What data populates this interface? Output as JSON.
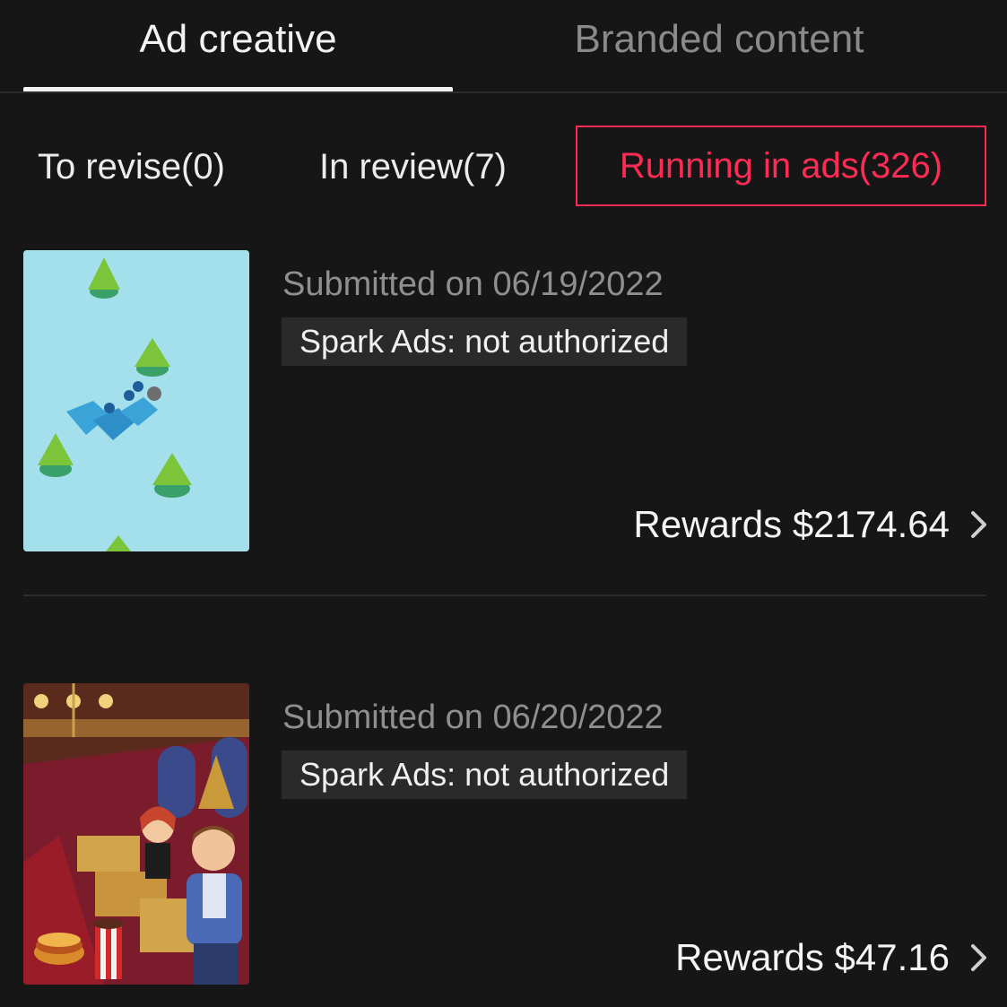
{
  "top_tabs": [
    {
      "label": "Ad creative",
      "active": true
    },
    {
      "label": "Branded content",
      "active": false
    }
  ],
  "sub_tabs": [
    {
      "label": "To revise(0)"
    },
    {
      "label": "In review(7)"
    },
    {
      "label": "Running in ads(326)",
      "selected": true
    }
  ],
  "items": [
    {
      "submitted": "Submitted on 06/19/2022",
      "badge": "Spark Ads: not authorized",
      "rewards": "Rewards $2174.64"
    },
    {
      "submitted": "Submitted on 06/20/2022",
      "badge": "Spark Ads: not authorized",
      "rewards": "Rewards $47.16"
    }
  ],
  "icons": {
    "chevron": "chevron-right-icon"
  },
  "colors": {
    "background": "#161616",
    "accent": "#fe2c55",
    "text_primary": "#f2f2f2",
    "text_secondary": "#8a8a8a",
    "badge_bg": "#2a2a2a"
  }
}
